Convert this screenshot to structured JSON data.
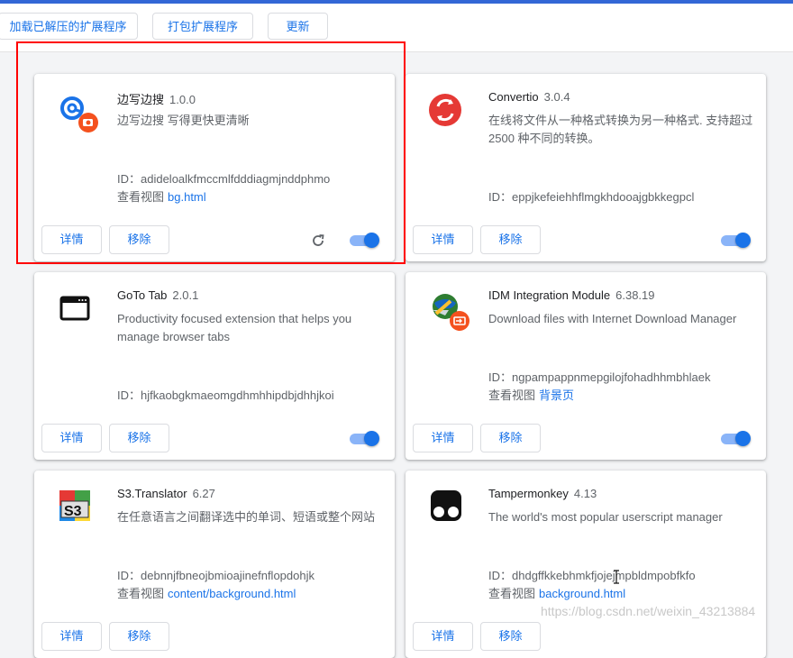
{
  "toolbar": {
    "load_unpacked": "加载已解压的扩展程序",
    "pack_extension": "打包扩展程序",
    "update": "更新"
  },
  "labels": {
    "details": "详情",
    "remove": "移除",
    "view_prefix": "查看视图"
  },
  "extensions": [
    {
      "name": "边写边搜",
      "version": "1.0.0",
      "description": "边写边搜 写得更快更清晰",
      "id": "ID：adideloalkfmccmlfdddiagmjnddphmo",
      "views": "bg.html",
      "enabled": true,
      "icon": "edit-search-icon"
    },
    {
      "name": "Convertio",
      "version": "3.0.4",
      "description": "在线将文件从一种格式转换为另一种格式. 支持超过 2500 种不同的转换。",
      "id": "ID：eppjkefeiehhflmgkhdooajgbkkegpcl",
      "views": "",
      "enabled": true,
      "icon": "convertio-icon"
    },
    {
      "name": "GoTo Tab",
      "version": "2.0.1",
      "description": "Productivity focused extension that helps you manage browser tabs",
      "id": "ID：hjfkaobgkmaeomgdhmhhipdbjdhhjkoi",
      "views": "",
      "enabled": true,
      "icon": "browser-window-icon"
    },
    {
      "name": "IDM Integration Module",
      "version": "6.38.19",
      "description": "Download files with Internet Download Manager",
      "id": "ID：ngpampappnmepgilojfohadhhmbhlaek",
      "views": "背景页",
      "enabled": true,
      "icon": "idm-globe-icon"
    },
    {
      "name": "S3.Translator",
      "version": "6.27",
      "description": "在任意语言之间翻译选中的单词、短语或整个网站",
      "id": "ID：debnnjfbneojbmioajinefnflopdohjk",
      "views": "content/background.html",
      "enabled": true,
      "icon": "s3-translator-icon"
    },
    {
      "name": "Tampermonkey",
      "version": "4.13",
      "description": "The world's most popular userscript manager",
      "id": "ID：dhdgffkkebhmkfjojejmpbldmpobfkfo",
      "views": "background.html",
      "enabled": true,
      "icon": "tampermonkey-icon"
    }
  ],
  "watermark": "https://blog.csdn.net/weixin_43213884",
  "colors": {
    "accent": "#1a73e8",
    "highlight_box": "#ff0000",
    "toggle_track": "#8ab4f8"
  }
}
